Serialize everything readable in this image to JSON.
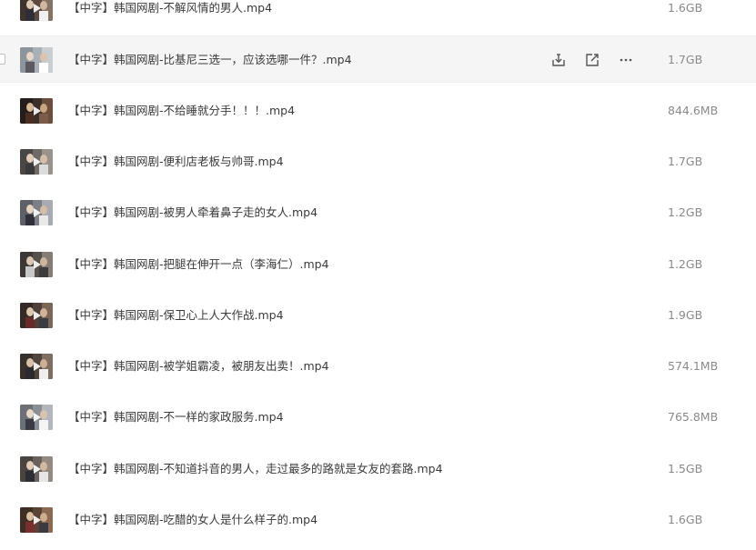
{
  "file_list": {
    "hovered_actions": {
      "download_icon": "download-icon",
      "share_icon": "share-icon",
      "more_icon": "more-icon"
    },
    "files": [
      {
        "name": "【中字】韩国网剧-不解风情的男人.mp4",
        "size": "1.6GB"
      },
      {
        "name": "【中字】韩国网剧-比基尼三选一，应该选哪一件？.mp4",
        "size": "1.7GB"
      },
      {
        "name": "【中字】韩国网剧-不给睡就分手！！！.mp4",
        "size": "844.6MB"
      },
      {
        "name": "【中字】韩国网剧-便利店老板与帅哥.mp4",
        "size": "1.7GB"
      },
      {
        "name": "【中字】韩国网剧-被男人牵着鼻子走的女人.mp4",
        "size": "1.2GB"
      },
      {
        "name": "【中字】韩国网剧-把腿在伸开一点（李海仁）.mp4",
        "size": "1.2GB"
      },
      {
        "name": "【中字】韩国网剧-保卫心上人大作战.mp4",
        "size": "1.9GB"
      },
      {
        "name": "【中字】韩国网剧-被学姐霸凌，被朋友出卖！.mp4",
        "size": "574.1MB"
      },
      {
        "name": "【中字】韩国网剧-不一样的家政服务.mp4",
        "size": "765.8MB"
      },
      {
        "name": "【中字】韩国网剧-不知道抖音的男人，走过最多的路就是女友的套路.mp4",
        "size": "1.5GB"
      },
      {
        "name": "【中字】韩国网剧-吃醋的女人是什么样子的.mp4",
        "size": "1.6GB"
      }
    ]
  }
}
